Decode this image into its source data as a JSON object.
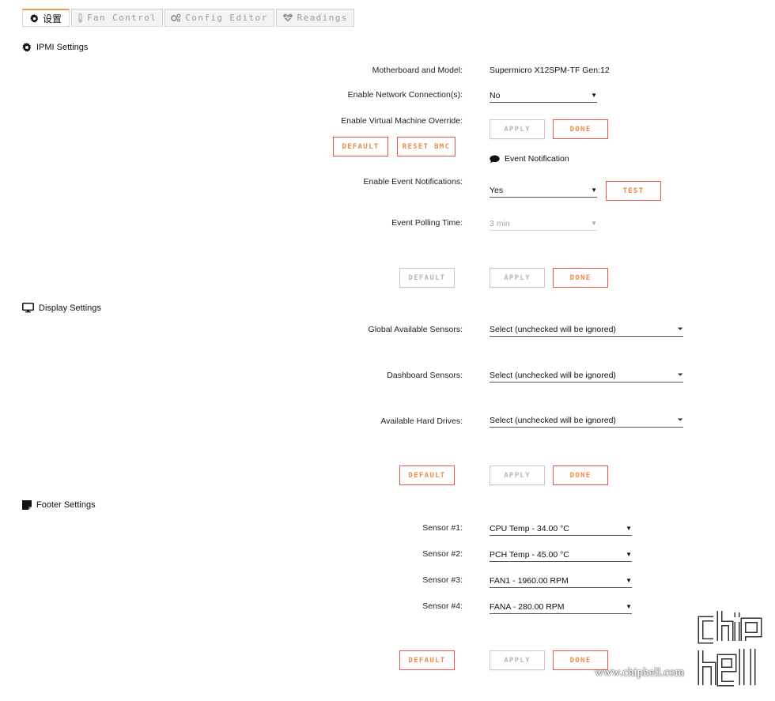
{
  "tabs": [
    {
      "label": "设置",
      "icon": "gear-icon",
      "active": true
    },
    {
      "label": "Fan Control",
      "icon": "thermometer-icon",
      "active": false
    },
    {
      "label": "Config Editor",
      "icon": "gears-icon",
      "active": false
    },
    {
      "label": "Readings",
      "icon": "heartbeat-icon",
      "active": false
    }
  ],
  "ipmi": {
    "title": "IPMI Settings",
    "motherboard_label": "Motherboard and Model:",
    "motherboard_value": "Supermicro X12SPM-TF Gen:12",
    "network_label": "Enable Network Connection(s):",
    "network_value": "No",
    "vm_override_label": "Enable Virtual Machine Override:",
    "apply_label": "APPLY",
    "done_label": "DONE",
    "default_label": "DEFAULT",
    "reset_bmc_label": "RESET BMC",
    "event_notification_title": "Event Notification",
    "event_enable_label": "Enable Event Notifications:",
    "event_enable_value": "Yes",
    "test_label": "TEST",
    "polling_label": "Event Polling Time:",
    "polling_value": "3 min",
    "default2_label": "DEFAULT",
    "apply2_label": "APPLY",
    "done2_label": "DONE"
  },
  "display": {
    "title": "Display Settings",
    "global_label": "Global Available Sensors:",
    "global_value": "Select (unchecked will be ignored)",
    "dashboard_label": "Dashboard Sensors:",
    "dashboard_value": "Select (unchecked will be ignored)",
    "drives_label": "Available Hard Drives:",
    "drives_value": "Select (unchecked will be ignored)",
    "default_label": "DEFAULT",
    "apply_label": "APPLY",
    "done_label": "DONE"
  },
  "footer": {
    "title": "Footer Settings",
    "sensor1_label": "Sensor #1:",
    "sensor1_value": "CPU Temp - 34.00 °C",
    "sensor2_label": "Sensor #2:",
    "sensor2_value": "PCH Temp - 45.00 °C",
    "sensor3_label": "Sensor #3:",
    "sensor3_value": "FAN1 - 1960.00 RPM",
    "sensor4_label": "Sensor #4:",
    "sensor4_value": "FANA - 280.00 RPM",
    "default_label": "DEFAULT",
    "apply_label": "APPLY",
    "done_label": "DONE"
  },
  "watermark": {
    "url": "www.chiphell.com",
    "logo_text": "chip hell"
  },
  "colors": {
    "accent_orange": "#f08a46",
    "accent_red": "#e8554e",
    "disabled_grey": "#b7b7b7"
  }
}
